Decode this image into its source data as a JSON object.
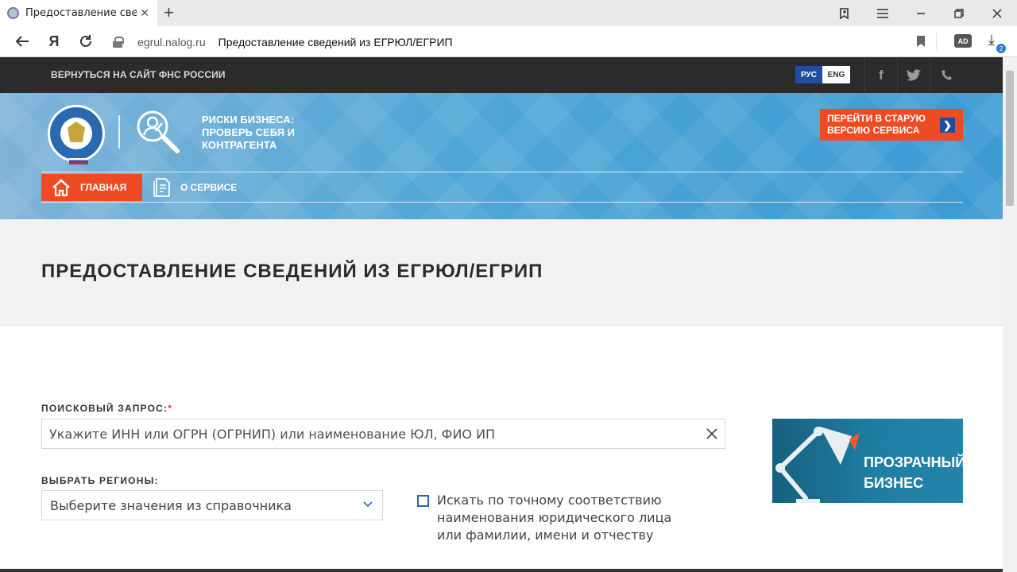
{
  "browser": {
    "tab_title": "Предоставление сведений",
    "tab_close": "✕",
    "new_tab": "+",
    "domain": "egrul.nalog.ru",
    "page_title": "Предоставление сведений из ЕГРЮЛ/ЕГРИП",
    "yandex_logo": "Я",
    "downloads_count": "2",
    "adblock_label": "AD"
  },
  "site": {
    "back_link": "ВЕРНУТЬСЯ НА САЙТ ФНС РОССИИ",
    "lang_ru": "РУС",
    "lang_en": "ENG",
    "brand_text": "РИСКИ БИЗНЕСА: ПРОВЕРЬ СЕБЯ И КОНТРАГЕНТА",
    "old_version_line1": "ПЕРЕЙТИ В СТАРУЮ",
    "old_version_line2": "ВЕРСИЮ СЕРВИСА",
    "menu": {
      "home": "ГЛАВНАЯ",
      "about": "О СЕРВИСЕ"
    }
  },
  "page": {
    "heading": "ПРЕДОСТАВЛЕНИЕ СВЕДЕНИЙ ИЗ ЕГРЮЛ/ЕГРИП",
    "search": {
      "label": "ПОИСКОВЫЙ ЗАПРОС:",
      "required_mark": "*",
      "placeholder": "Укажите ИНН или ОГРН (ОГРНИП) или наименование ЮЛ, ФИО ИП",
      "value": ""
    },
    "regions": {
      "label": "ВЫБРАТЬ РЕГИОНЫ:",
      "selected": "Выберите значения из справочника"
    },
    "exact_match": {
      "checked": false,
      "label": "Искать по точному соответствию наименования юридического лица или фамилии, имени и отчеству"
    },
    "promo": {
      "line1": "ПРОЗРАЧНЫЙ",
      "line2": "БИЗНЕС"
    }
  },
  "colors": {
    "accent_orange": "#ef4b22",
    "accent_blue": "#1f4ea1",
    "top_strip": "#2b2b2b",
    "banner_blue": "#4fa6d6"
  }
}
